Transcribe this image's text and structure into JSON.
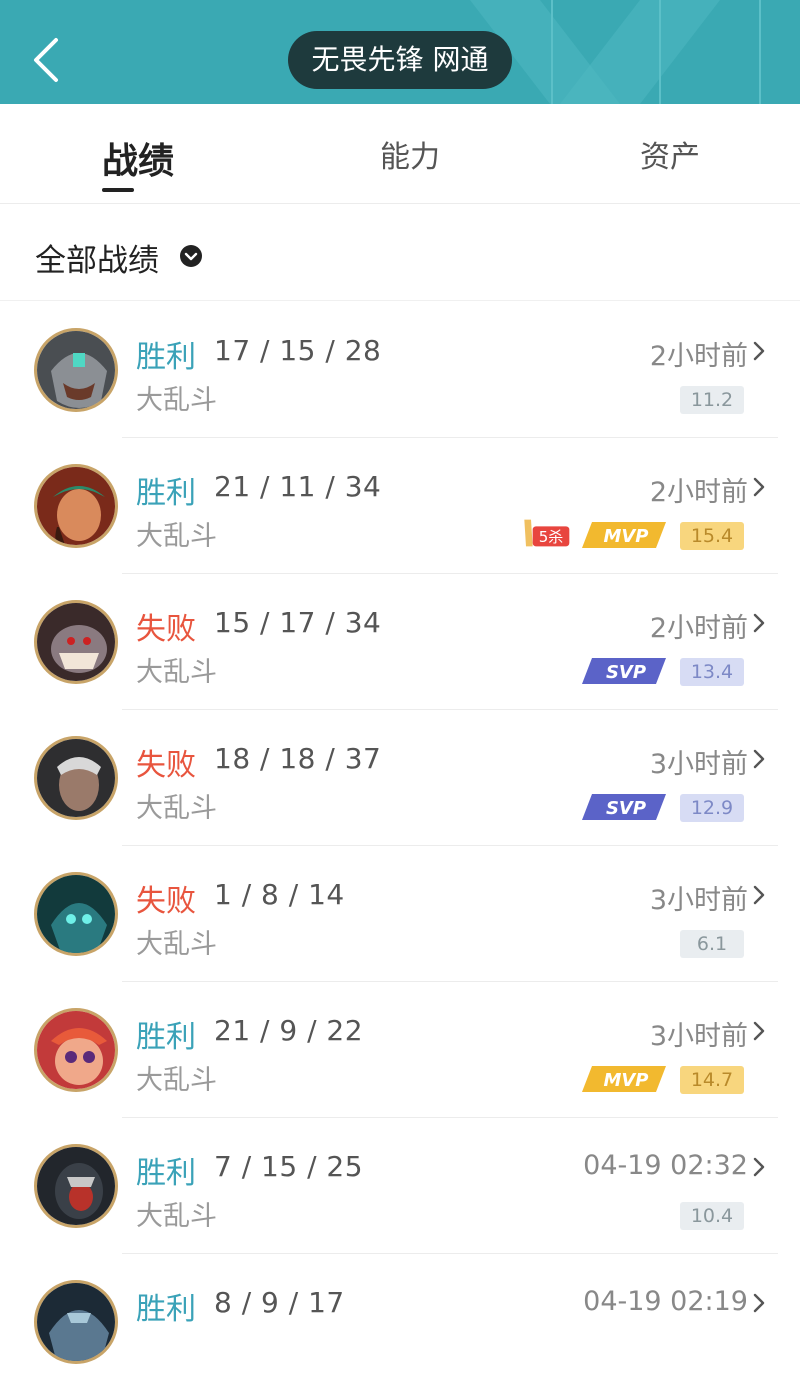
{
  "header": {
    "title": "无畏先锋 网通"
  },
  "tabs": [
    {
      "label": "战绩",
      "active": true
    },
    {
      "label": "能力",
      "active": false
    },
    {
      "label": "资产",
      "active": false
    }
  ],
  "filter": {
    "label": "全部战绩"
  },
  "colors": {
    "header": "#3aa9b3",
    "win": "#3aa2b8",
    "lose": "#e8553e",
    "mvp": "#f2b92f",
    "svp": "#5b63c8"
  },
  "matches": [
    {
      "result": "胜利",
      "outcome": "win",
      "kda": "17 / 15 / 28",
      "mode": "大乱斗",
      "time": "2小时前",
      "score": "11.2",
      "score_style": "grey",
      "badges": []
    },
    {
      "result": "胜利",
      "outcome": "win",
      "kda": "21 / 11 / 34",
      "mode": "大乱斗",
      "time": "2小时前",
      "score": "15.4",
      "score_style": "gold",
      "badges": [
        "5杀",
        "MVP"
      ]
    },
    {
      "result": "失败",
      "outcome": "lose",
      "kda": "15 / 17 / 34",
      "mode": "大乱斗",
      "time": "2小时前",
      "score": "13.4",
      "score_style": "blue",
      "badges": [
        "SVP"
      ]
    },
    {
      "result": "失败",
      "outcome": "lose",
      "kda": "18 / 18 / 37",
      "mode": "大乱斗",
      "time": "3小时前",
      "score": "12.9",
      "score_style": "blue",
      "badges": [
        "SVP"
      ]
    },
    {
      "result": "失败",
      "outcome": "lose",
      "kda": "1 / 8 / 14",
      "mode": "大乱斗",
      "time": "3小时前",
      "score": "6.1",
      "score_style": "grey",
      "badges": []
    },
    {
      "result": "胜利",
      "outcome": "win",
      "kda": "21 / 9 / 22",
      "mode": "大乱斗",
      "time": "3小时前",
      "score": "14.7",
      "score_style": "gold",
      "badges": [
        "MVP"
      ]
    },
    {
      "result": "胜利",
      "outcome": "win",
      "kda": "7 / 15 / 25",
      "mode": "大乱斗",
      "time": "04-19 02:32",
      "score": "10.4",
      "score_style": "grey",
      "badges": []
    },
    {
      "result": "胜利",
      "outcome": "win",
      "kda": "8 / 9 / 17",
      "mode": "",
      "time": "04-19 02:19",
      "score": "",
      "score_style": "grey",
      "badges": []
    }
  ]
}
